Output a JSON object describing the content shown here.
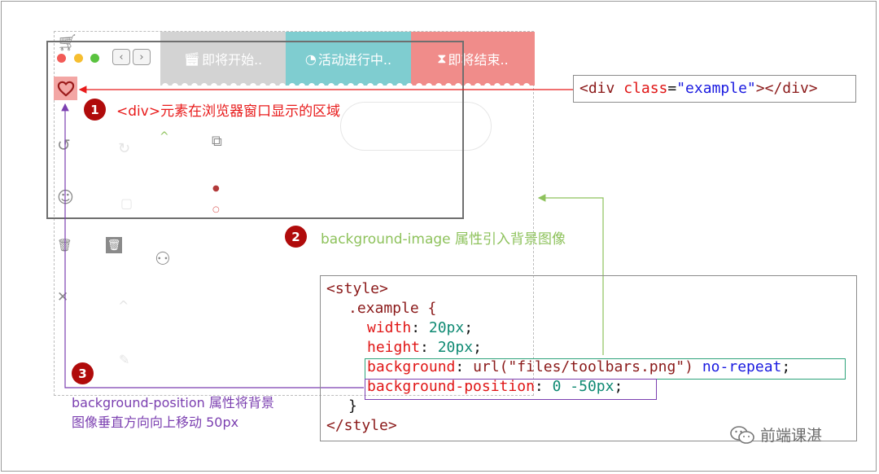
{
  "tabs": [
    {
      "icon": "clapper-icon",
      "label": "即将开始.."
    },
    {
      "icon": "clock-check-icon",
      "label": "活动进行中.."
    },
    {
      "icon": "hourglass-icon",
      "label": "即将结束.."
    }
  ],
  "colors": {
    "tab_gray": "#d3d3d3",
    "tab_teal": "#7fcdd0",
    "tab_pink": "#f08c8a",
    "annotation_red": "#e81b1b",
    "annotation_green": "#8ec25c",
    "annotation_purple": "#7b3fb0",
    "badge": "#b00b0b"
  },
  "annotations": {
    "step1": {
      "number": "1",
      "text": "<div>元素在浏览器窗口显示的区域"
    },
    "step2": {
      "number": "2",
      "text": "background-image 属性引入背景图像"
    },
    "step3": {
      "number": "3",
      "line1": "background-position 属性将背景",
      "line2": "图像垂直方向向上移动 50px"
    }
  },
  "html_code": {
    "open": "<div ",
    "attr": "class",
    "eq": "=",
    "value": "\"example\"",
    "close": "></div>"
  },
  "css_code": {
    "style_open": "<style>",
    "selector": ".example {",
    "width_prop": "width",
    "width_val": "20px",
    "height_prop": "height",
    "height_val": "20px",
    "bg_prop": "background",
    "bg_url": "url(\"files/toolbars.png\")",
    "bg_repeat": "no-repeat",
    "bgpos_prop": "background-position",
    "bgpos_val": "0 -50px",
    "brace_close": "}",
    "style_close": "</style>",
    "colon": ": ",
    "semicolon": ";"
  },
  "watermark": {
    "text": "前端课湛"
  }
}
